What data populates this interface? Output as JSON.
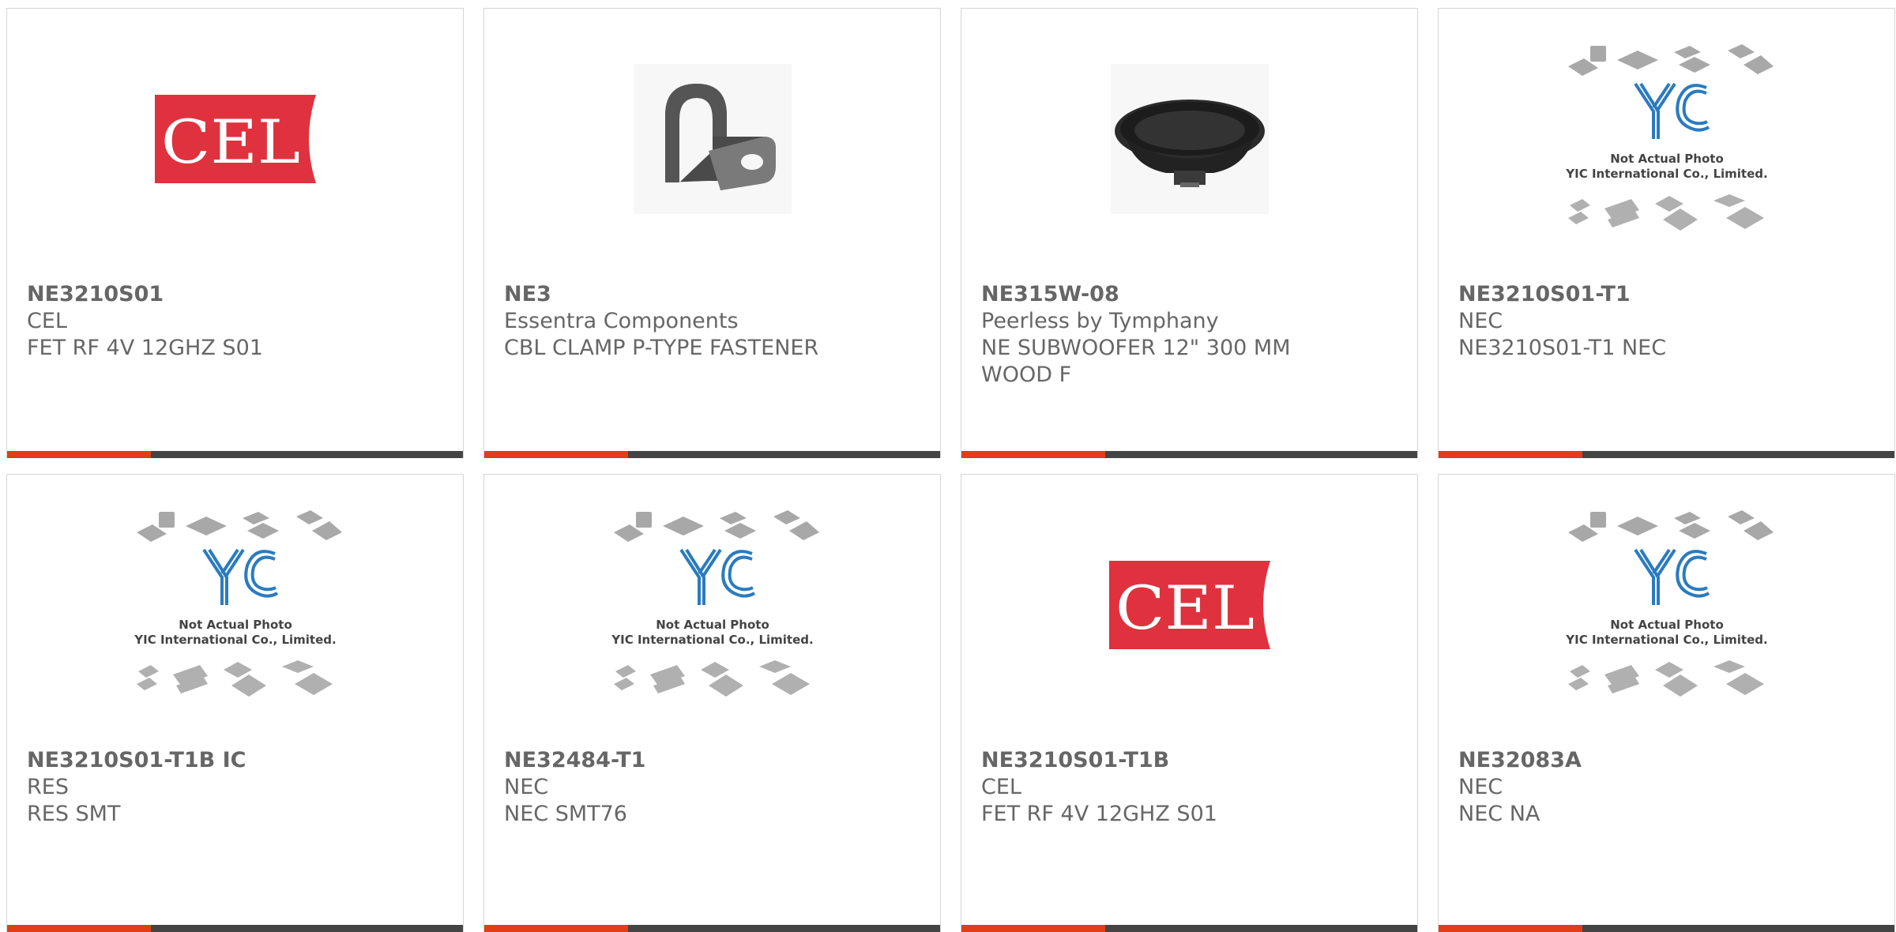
{
  "colors": {
    "accent": "#e23d17",
    "bar": "#444444",
    "text": "#666666",
    "cel_red": "#e0323e",
    "yic_blue": "#2a7bc0"
  },
  "placeholder": {
    "line1": "Not Actual Photo",
    "line2": "YIC International Co., Limited."
  },
  "products": [
    {
      "part": "NE3210S01",
      "manufacturer": "CEL",
      "description": "FET RF 4V 12GHZ S01",
      "image": "cel-logo"
    },
    {
      "part": "NE3",
      "manufacturer": "Essentra Components",
      "description": "CBL CLAMP P-TYPE FASTENER",
      "image": "cable-clamp-photo"
    },
    {
      "part": "NE315W-08",
      "manufacturer": "Peerless by Tymphany",
      "description": "NE SUBWOOFER 12\" 300 MM WOOD F",
      "image": "subwoofer-photo"
    },
    {
      "part": "NE3210S01-T1",
      "manufacturer": "NEC",
      "description": "NE3210S01-T1 NEC",
      "image": "not-actual-photo"
    },
    {
      "part": "NE3210S01-T1B IC",
      "manufacturer": "RES",
      "description": "RES SMT",
      "image": "not-actual-photo"
    },
    {
      "part": "NE32484-T1",
      "manufacturer": "NEC",
      "description": "NEC SMT76",
      "image": "not-actual-photo"
    },
    {
      "part": "NE3210S01-T1B",
      "manufacturer": "CEL",
      "description": "FET RF 4V 12GHZ S01",
      "image": "cel-logo"
    },
    {
      "part": "NE32083A",
      "manufacturer": "NEC",
      "description": "NEC NA",
      "image": "not-actual-photo"
    }
  ]
}
